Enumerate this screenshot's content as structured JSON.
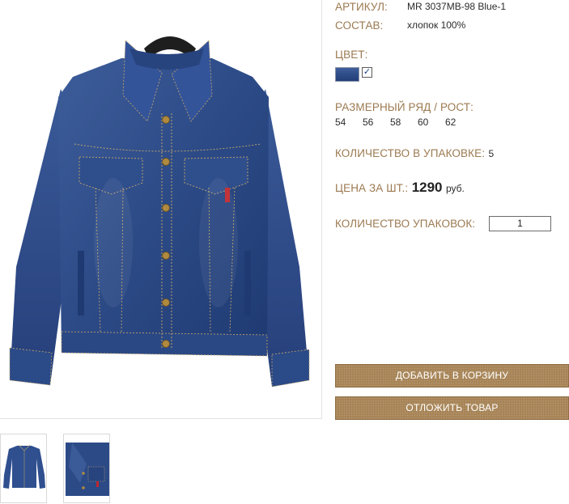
{
  "product": {
    "sku_label": "АРТИКУЛ:",
    "sku_value": "MR 3037MB-98 Blue-1",
    "composition_label": "СОСТАВ:",
    "composition_value": "хлопок 100%",
    "color_label": "ЦВЕТ:",
    "color_swatch": "#2e4c87",
    "color_check": "✓",
    "sizes_label": "РАЗМЕРНЫЙ РЯД / РОСТ:",
    "sizes": [
      "54",
      "56",
      "58",
      "60",
      "62"
    ],
    "pack_qty_label": "КОЛИЧЕСТВО В УПАКОВКЕ:",
    "pack_qty_value": "5",
    "price_label": "ЦЕНА ЗА ШТ.:",
    "price_value": "1290",
    "price_currency": "руб.",
    "packs_label": "КОЛИЧЕСТВО УПАКОВОК:",
    "packs_value": "1"
  },
  "actions": {
    "add_to_cart": "ДОБАВИТЬ В КОРЗИНУ",
    "save_for_later": "ОТЛОЖИТЬ ТОВАР"
  },
  "colors": {
    "label_accent": "#9c7a51",
    "button_bg": "#a37f4f",
    "denim": "#2e4c87"
  }
}
